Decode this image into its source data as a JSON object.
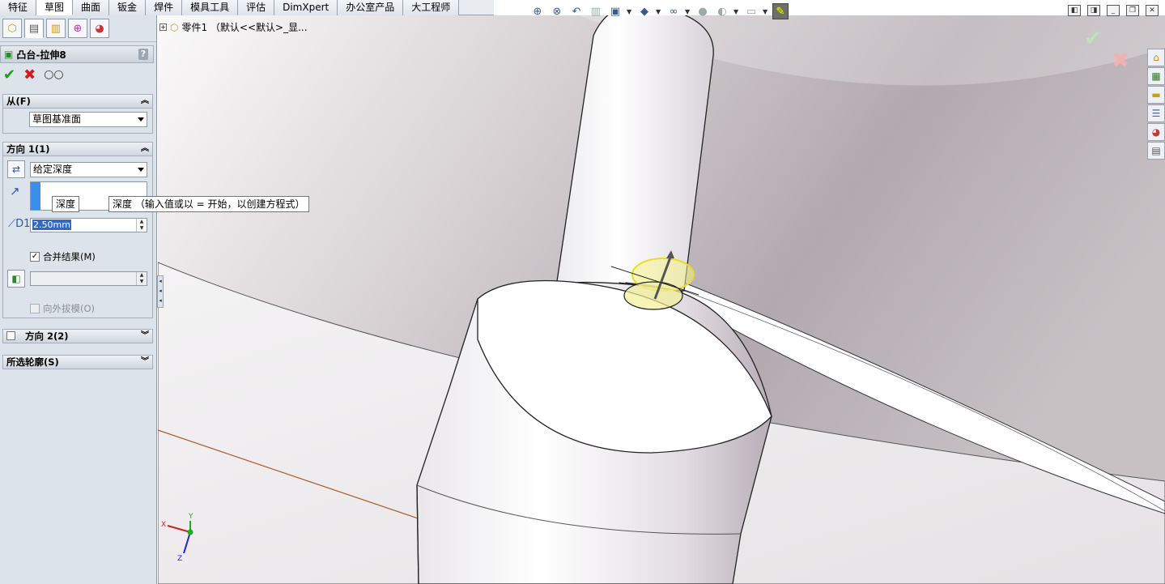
{
  "tabs": [
    "特征",
    "草图",
    "曲面",
    "钣金",
    "焊件",
    "模具工具",
    "评估",
    "DimXpert",
    "办公室产品",
    "大工程师"
  ],
  "active_tab_index": 1,
  "tree": {
    "label": "零件1 （默认<<默认>_显..."
  },
  "pm": {
    "title": "凸台-拉伸8",
    "help": "?",
    "from": {
      "header": "从(F)",
      "value": "草图基准面"
    },
    "dir1": {
      "header": "方向 1(1)",
      "end_condition": "给定深度",
      "depth_value": "2.50mm",
      "merge_label": "合并结果(M)",
      "merge_checked": "✓",
      "draft_label": "向外拔模(O)"
    },
    "dir2": {
      "header": "方向 2(2)"
    },
    "contours": {
      "header": "所选轮廓(S)"
    }
  },
  "tooltips": {
    "small": "深度",
    "long": "深度 （输入值或以 = 开始，以创建方程式）"
  },
  "colors": {
    "selection_yellow": "#f6f28a",
    "body_white": "#f4f2f4",
    "bg_gray": "#b9b3b8",
    "sketch_line": "#a55a2a"
  },
  "triad": {
    "x": "X",
    "y": "Y",
    "z": "Z"
  }
}
